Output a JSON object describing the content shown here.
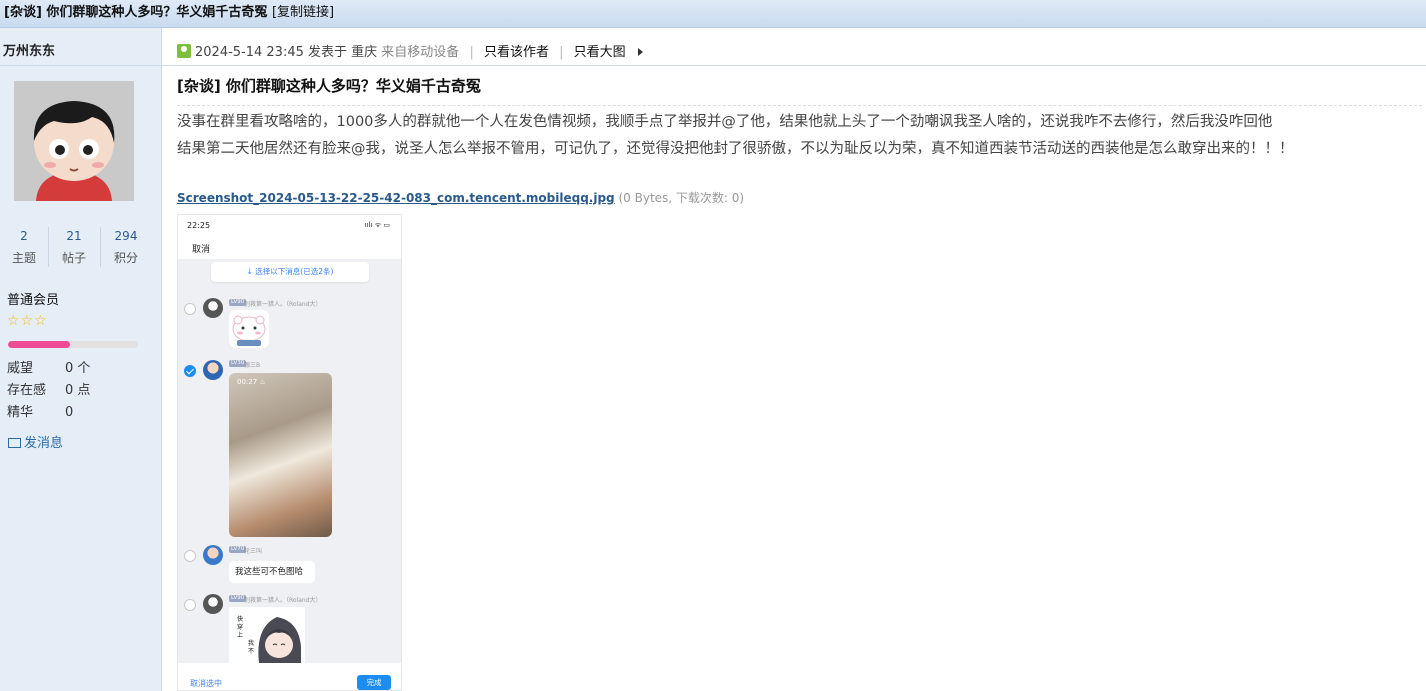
{
  "page_title": "[杂谈] 你们群聊这种人多吗？华义娟千古奇冤",
  "copy_link": "[复制链接]",
  "user": {
    "name": "万州东东",
    "stats": [
      {
        "value": "2",
        "label": "主题"
      },
      {
        "value": "21",
        "label": "帖子"
      },
      {
        "value": "294",
        "label": "积分"
      }
    ],
    "group": "普通会员",
    "stars": "☆☆☆",
    "level_progress": 0.48,
    "attributes": [
      {
        "key": "威望",
        "value": "0 个"
      },
      {
        "key": "存在感",
        "value": "0 点"
      },
      {
        "key": "精华",
        "value": "0"
      }
    ],
    "send_message": "发消息"
  },
  "post": {
    "datetime": "2024-5-14 23:45",
    "posted_in": "发表于 重庆",
    "device": "来自移动设备",
    "only_author": "只看该作者",
    "only_images": "只看大图",
    "title": "[杂谈] 你们群聊这种人多吗？华义娟千古奇冤",
    "content": [
      "没事在群里看攻略啥的，1000多人的群就他一个人在发色情视频，我顺手点了举报并@了他，结果他就上头了一个劲嘲讽我圣人啥的，还说我咋不去修行，然后我没咋回他",
      "结果第二天他居然还有脸来@我，说圣人怎么举报不管用，可记仇了，还觉得没把他封了很骄傲，不以为耻反以为荣，真不知道西装节活动送的西装他是怎么敢穿出来的！！！"
    ],
    "attachment": {
      "filename": "Screenshot_2024-05-13-22-25-42-083_com.tencent.mobileqq.jpg",
      "info": "(0 Bytes, 下载次数: 0)"
    }
  },
  "phone": {
    "time": "22:25",
    "status_icons": "ıılı ᯤ ▭",
    "cancel": "取消",
    "select_hint": "↓ 选择以下消息(已选2条)",
    "messages": [
      {
        "tag": "LV90",
        "nick": "别救第一猎人。（Roland大）"
      },
      {
        "tag": "LV30",
        "nick": "源三B"
      },
      {
        "tag": "LV70",
        "nick": "轮三叫"
      },
      {
        "tag": "LV90",
        "nick": "别救第一猎人。（Roland大）"
      }
    ],
    "video_time": "00:27 ♨",
    "bubble_text": "我这些可不色图哈",
    "unselect": "取消选中",
    "done": "完成"
  }
}
